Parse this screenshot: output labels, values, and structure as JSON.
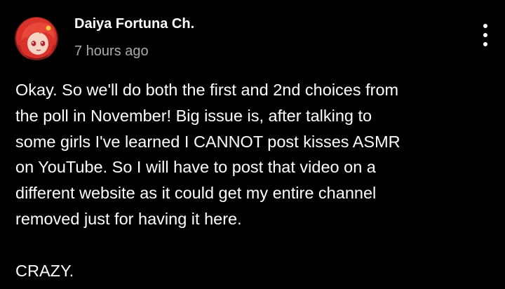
{
  "post": {
    "author": "Daiya Fortuna Ch.",
    "timestamp": "7 hours ago",
    "menu_icon": "more-vertical-icon",
    "avatar_icon": "avatar-image",
    "body_lines": [
      "Okay. So we'll do both the first and 2nd choices from",
      "the poll in November! Big issue is, after talking to",
      "some girls I've learned I CANNOT post kisses ASMR",
      "on YouTube. So I will have to post that video on a",
      "different website as it could get my entire channel",
      "removed just for having it here."
    ],
    "closing_line": "CRAZY."
  },
  "colors": {
    "background": "#000000",
    "text": "#ffffff",
    "timestamp": "#aaaaaa",
    "avatar_hair": "#d8322b"
  }
}
